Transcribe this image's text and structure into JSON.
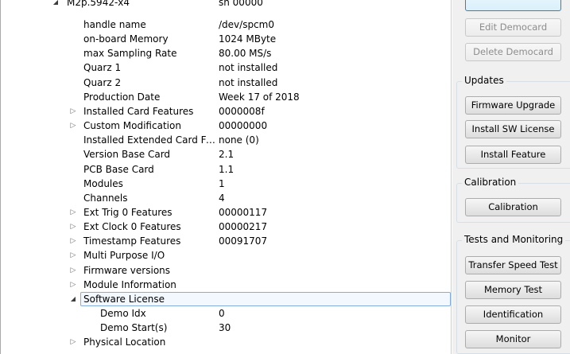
{
  "tree": {
    "card_label": "M2p.5942-x4",
    "card_value": "sn 00000",
    "rows": [
      {
        "label": "handle name",
        "value": "/dev/spcm0",
        "arrow": ""
      },
      {
        "label": "on-board Memory",
        "value": "1024 MByte",
        "arrow": ""
      },
      {
        "label": "max Sampling Rate",
        "value": "80.00 MS/s",
        "arrow": ""
      },
      {
        "label": "Quarz 1",
        "value": "not installed",
        "arrow": ""
      },
      {
        "label": "Quarz 2",
        "value": "not installed",
        "arrow": ""
      },
      {
        "label": "Production Date",
        "value": "Week 17 of 2018",
        "arrow": ""
      },
      {
        "label": "Installed Card Features",
        "value": "0000008f",
        "arrow": "collapsed"
      },
      {
        "label": "Custom Modification",
        "value": "00000000",
        "arrow": "collapsed"
      },
      {
        "label": "Installed Extended Card Fea...",
        "value": "none (0)",
        "arrow": ""
      },
      {
        "label": "Version Base Card",
        "value": "2.1",
        "arrow": ""
      },
      {
        "label": "PCB Base Card",
        "value": "1.1",
        "arrow": ""
      },
      {
        "label": "Modules",
        "value": "1",
        "arrow": ""
      },
      {
        "label": "Channels",
        "value": "4",
        "arrow": ""
      },
      {
        "label": "Ext Trig 0 Features",
        "value": "00000117",
        "arrow": "collapsed"
      },
      {
        "label": "Ext Clock 0 Features",
        "value": "00000217",
        "arrow": "collapsed"
      },
      {
        "label": "Timestamp Features",
        "value": "00091707",
        "arrow": "collapsed"
      },
      {
        "label": "Multi Purpose I/O",
        "value": "",
        "arrow": "collapsed"
      },
      {
        "label": "Firmware versions",
        "value": "",
        "arrow": "collapsed"
      },
      {
        "label": "Module Information",
        "value": "",
        "arrow": "collapsed"
      },
      {
        "label": "Software License",
        "value": "",
        "arrow": "expanded",
        "selected": true
      },
      {
        "label": "Demo Idx",
        "value": "0",
        "arrow": "",
        "child": true
      },
      {
        "label": "Demo Start(s)",
        "value": "30",
        "arrow": "",
        "child": true
      },
      {
        "label": "Physical Location",
        "value": "",
        "arrow": "collapsed"
      }
    ]
  },
  "right_pane": {
    "edit_democard": "Edit Democard",
    "delete_democard": "Delete Democard",
    "updates": {
      "title": "Updates",
      "firmware_upgrade": "Firmware Upgrade",
      "install_sw_license": "Install SW License",
      "install_feature": "Install Feature"
    },
    "calibration": {
      "title": "Calibration",
      "calibration": "Calibration"
    },
    "tests": {
      "title": "Tests and Monitoring",
      "transfer_speed_test": "Transfer Speed Test",
      "memory_test": "Memory Test",
      "identification": "Identification",
      "monitor": "Monitor"
    }
  }
}
